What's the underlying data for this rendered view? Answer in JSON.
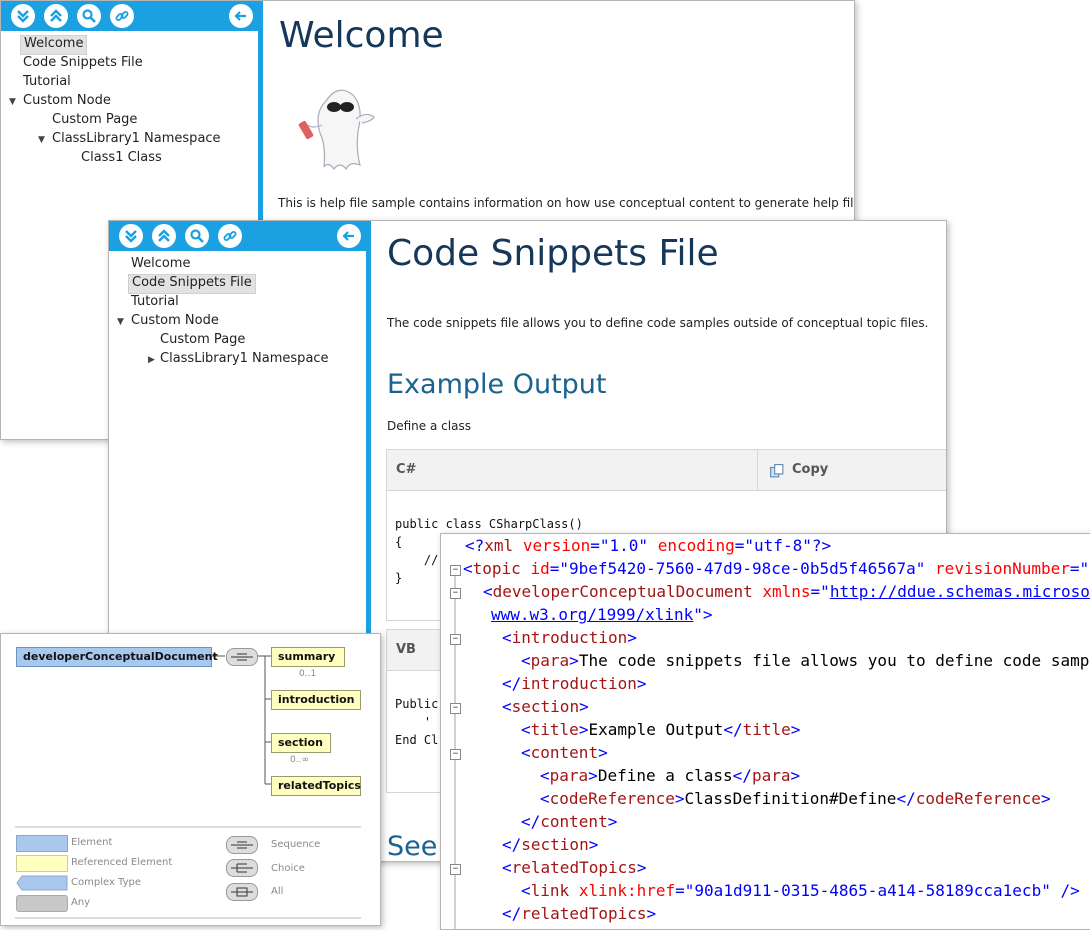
{
  "colors": {
    "accent": "#1ba1e2",
    "heading": "#15385a",
    "subheading": "#1a6290"
  },
  "window1": {
    "toolbar_icons": [
      "expand-all-icon",
      "collapse-all-icon",
      "search-icon",
      "link-icon",
      "back-icon"
    ],
    "tree": [
      {
        "label": "Welcome"
      },
      {
        "label": "Code Snippets File"
      },
      {
        "label": "Tutorial"
      },
      {
        "label": "Custom Node"
      },
      {
        "label": "Custom Page"
      },
      {
        "label": "ClassLibrary1 Namespace"
      },
      {
        "label": "Class1 Class"
      }
    ],
    "title": "Welcome",
    "body": "This is help file sample contains information on how use conceptual content to generate help file."
  },
  "window2": {
    "tree": [
      {
        "label": "Welcome"
      },
      {
        "label": "Code Snippets File"
      },
      {
        "label": "Tutorial"
      },
      {
        "label": "Custom Node"
      },
      {
        "label": "Custom Page"
      },
      {
        "label": "ClassLibrary1 Namespace"
      }
    ],
    "title": "Code Snippets File",
    "intro": "The code snippets file allows you to define code samples outside of conceptual topic files.",
    "section_title": "Example Output",
    "define_text": "Define a class",
    "code_cs": {
      "lang": "C#",
      "copy": "Copy",
      "lines": [
        "public class CSharpClass()",
        "{",
        "    //",
        "}"
      ]
    },
    "code_vb": {
      "lang": "VB",
      "lines": [
        "Public",
        "    '",
        "End Cl"
      ]
    },
    "see_also": "See"
  },
  "schema": {
    "root": "developerConceptualDocument",
    "children": [
      {
        "label": "summary",
        "occurs": "0..1"
      },
      {
        "label": "introduction",
        "occurs": ""
      },
      {
        "label": "section",
        "occurs": "0..∞"
      },
      {
        "label": "relatedTopics",
        "occurs": ""
      }
    ],
    "legend": {
      "element": "Element",
      "referenced": "Referenced Element",
      "complex": "Complex Type",
      "any": "Any",
      "sequence": "Sequence",
      "choice": "Choice",
      "all": "All"
    }
  },
  "xml": {
    "decl_version": "\"1.0\"",
    "decl_encoding": "\"utf-8\"",
    "topic_id": "\"9bef5420-7560-47d9-98ce-0b5d5f46567a\"",
    "topic_rev_attr": "revisionNumber",
    "doc_tag": "developerConceptualDocument",
    "xmlns_url": "http://ddue.schemas.microso",
    "xlink_url": "www.w3.org/1999/xlink",
    "intro_para": "The code snippets file allows you to define code samp",
    "section_title": "Example Output",
    "section_para": "Define a class",
    "code_ref": "ClassDefinition#Define",
    "link_href": "\"90a1d911-0315-4865-a414-58189cca1ecb\""
  }
}
